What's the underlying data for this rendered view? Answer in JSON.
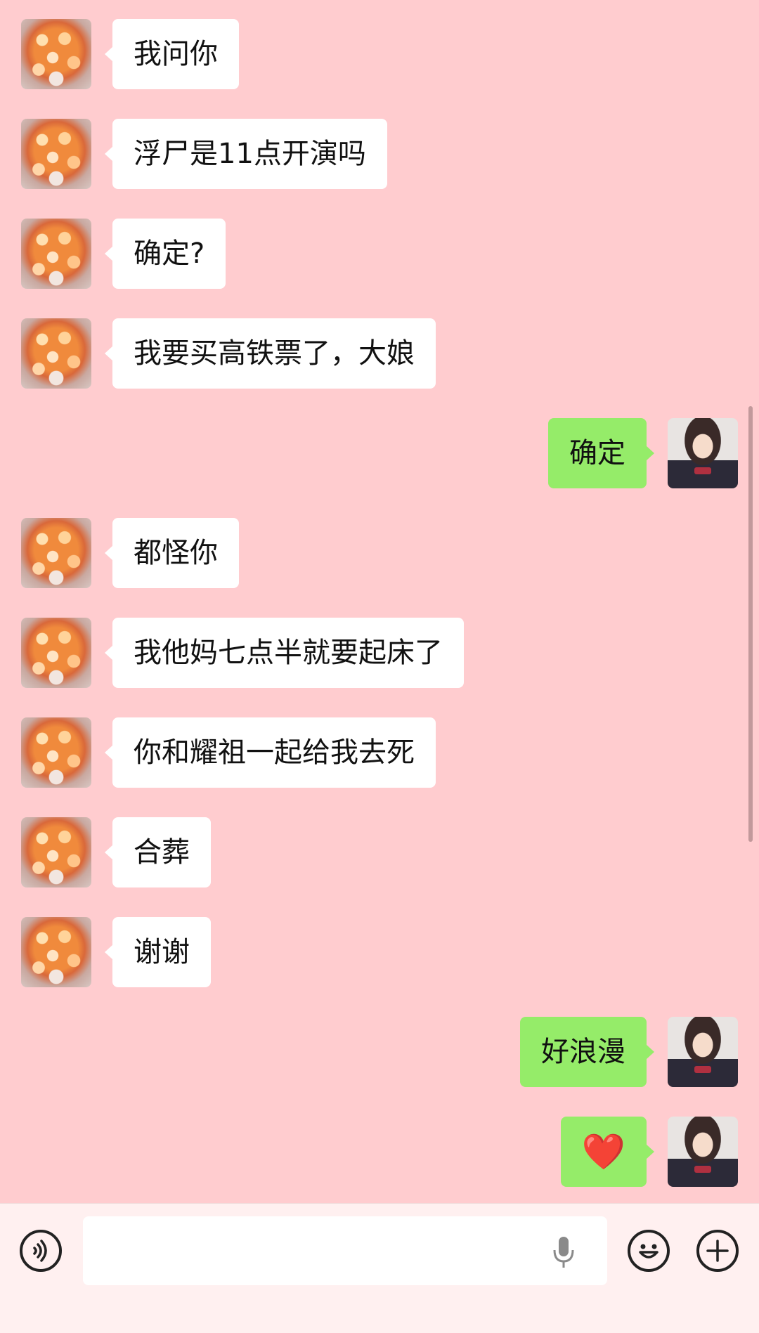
{
  "messages": [
    {
      "side": "in",
      "text": "我问你"
    },
    {
      "side": "in",
      "text": "浮尸是11点开演吗"
    },
    {
      "side": "in",
      "text": "确定?"
    },
    {
      "side": "in",
      "text": "我要买高铁票了，大娘"
    },
    {
      "side": "out",
      "text": "确定"
    },
    {
      "side": "in",
      "text": "都怪你"
    },
    {
      "side": "in",
      "text": "我他妈七点半就要起床了"
    },
    {
      "side": "in",
      "text": "你和耀祖一起给我去死"
    },
    {
      "side": "in",
      "text": "合葬"
    },
    {
      "side": "in",
      "text": "谢谢"
    },
    {
      "side": "out",
      "text": "好浪漫"
    },
    {
      "side": "out",
      "text": "❤️",
      "kind": "heart"
    }
  ],
  "input_bar": {
    "text_value": "",
    "voice_icon": "voice-icon",
    "mic_icon": "microphone-icon",
    "emoji_icon": "emoji-icon",
    "plus_icon": "plus-icon"
  },
  "colors": {
    "background": "#ffcccf",
    "incoming_bubble": "#ffffff",
    "outgoing_bubble": "#95ec69",
    "input_bar": "#fff0f0"
  }
}
